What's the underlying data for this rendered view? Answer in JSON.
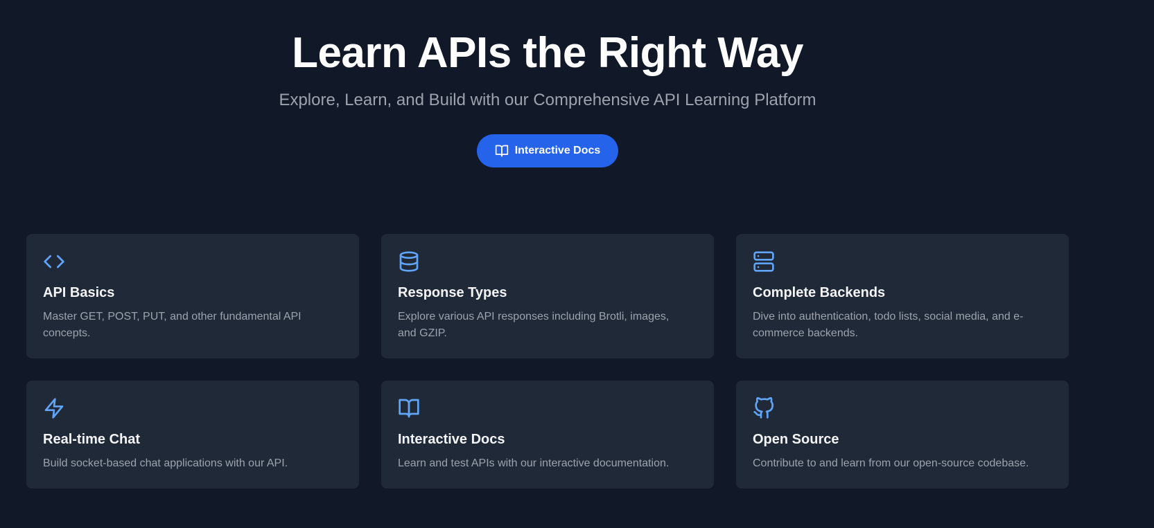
{
  "hero": {
    "title": "Learn APIs the Right Way",
    "subtitle": "Explore, Learn, and Build with our Comprehensive API Learning Platform",
    "cta_label": "Interactive Docs",
    "cta_icon": "book-open-icon"
  },
  "colors": {
    "background": "#111827",
    "card_background": "#1f2937",
    "accent": "#2563eb",
    "icon": "#60a5fa"
  },
  "features": [
    {
      "icon": "code-icon",
      "title": "API Basics",
      "description": "Master GET, POST, PUT, and other fundamental API concepts."
    },
    {
      "icon": "database-icon",
      "title": "Response Types",
      "description": "Explore various API responses including Brotli, images, and GZIP."
    },
    {
      "icon": "server-icon",
      "title": "Complete Backends",
      "description": "Dive into authentication, todo lists, social media, and e-commerce backends."
    },
    {
      "icon": "zap-icon",
      "title": "Real-time Chat",
      "description": "Build socket-based chat applications with our API."
    },
    {
      "icon": "book-open-icon",
      "title": "Interactive Docs",
      "description": "Learn and test APIs with our interactive documentation."
    },
    {
      "icon": "github-icon",
      "title": "Open Source",
      "description": "Contribute to and learn from our open-source codebase."
    }
  ]
}
